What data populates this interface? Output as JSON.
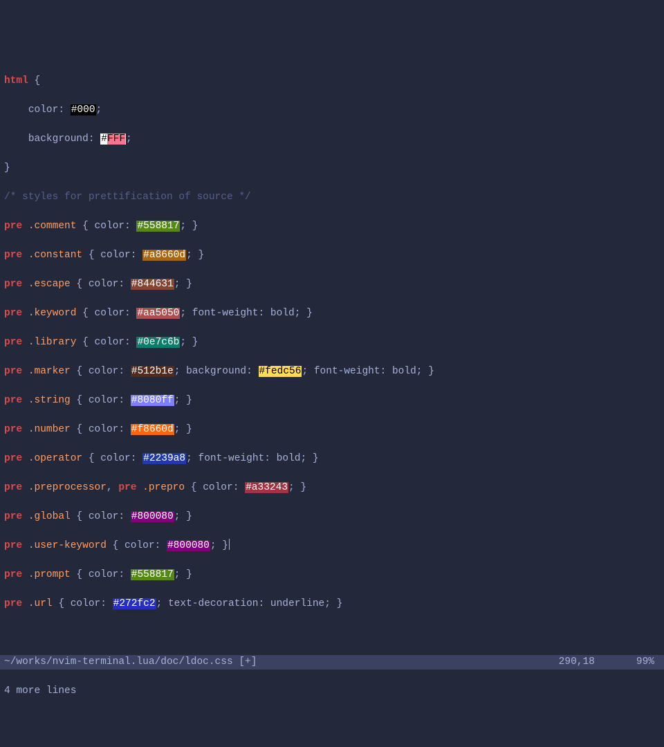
{
  "code": {
    "selector_html": "html",
    "brace_open": " {",
    "indent": "    ",
    "prop_color": "color: ",
    "val_000": "#000",
    "semicolon": ";",
    "prop_background": "background: ",
    "val_FFF_hash": "#",
    "val_FFF_text": "FFF",
    "brace_close": "}",
    "comment": "/* styles for prettification of source */",
    "pre": "pre",
    "space": " ",
    "open": " { ",
    "color_label": "color: ",
    "bg_label": "background: ",
    "fw_bold": "font-weight: bold",
    "td_underline": "text-decoration: underline",
    "close": "; }",
    "close2": "; }",
    "sep_semi": "; ",
    "comma": ", ",
    "classes": {
      "comment": ".comment",
      "constant": ".constant",
      "escape": ".escape",
      "keyword": ".keyword",
      "library": ".library",
      "marker": ".marker",
      "string": ".string",
      "number": ".number",
      "operator": ".operator",
      "preprocessor": ".preprocessor",
      "prepro": ".prepro",
      "global": ".global",
      "userkw": ".user-keyword",
      "prompt": ".prompt",
      "url": ".url"
    },
    "hex": {
      "h558817": "#558817",
      "ha8660d": "#a8660d",
      "h844631": "#844631",
      "haa5050": "#aa5050",
      "h0e7c6b": "#0e7c6b",
      "h512b1e": "#512b1e",
      "hfedc56": "#fedc56",
      "h8080ff": "#8080ff",
      "hf8660d": "#f8660d",
      "h2239a8": "#2239a8",
      "ha33243": "#a33243",
      "h800080": "#800080",
      "h272fc2": "#272fc2"
    }
  },
  "statusbar": {
    "path": "~/works/nvim-terminal.lua/doc/ldoc.css [+]",
    "position": "290,18",
    "percent": "99%"
  },
  "message": "4 more lines"
}
